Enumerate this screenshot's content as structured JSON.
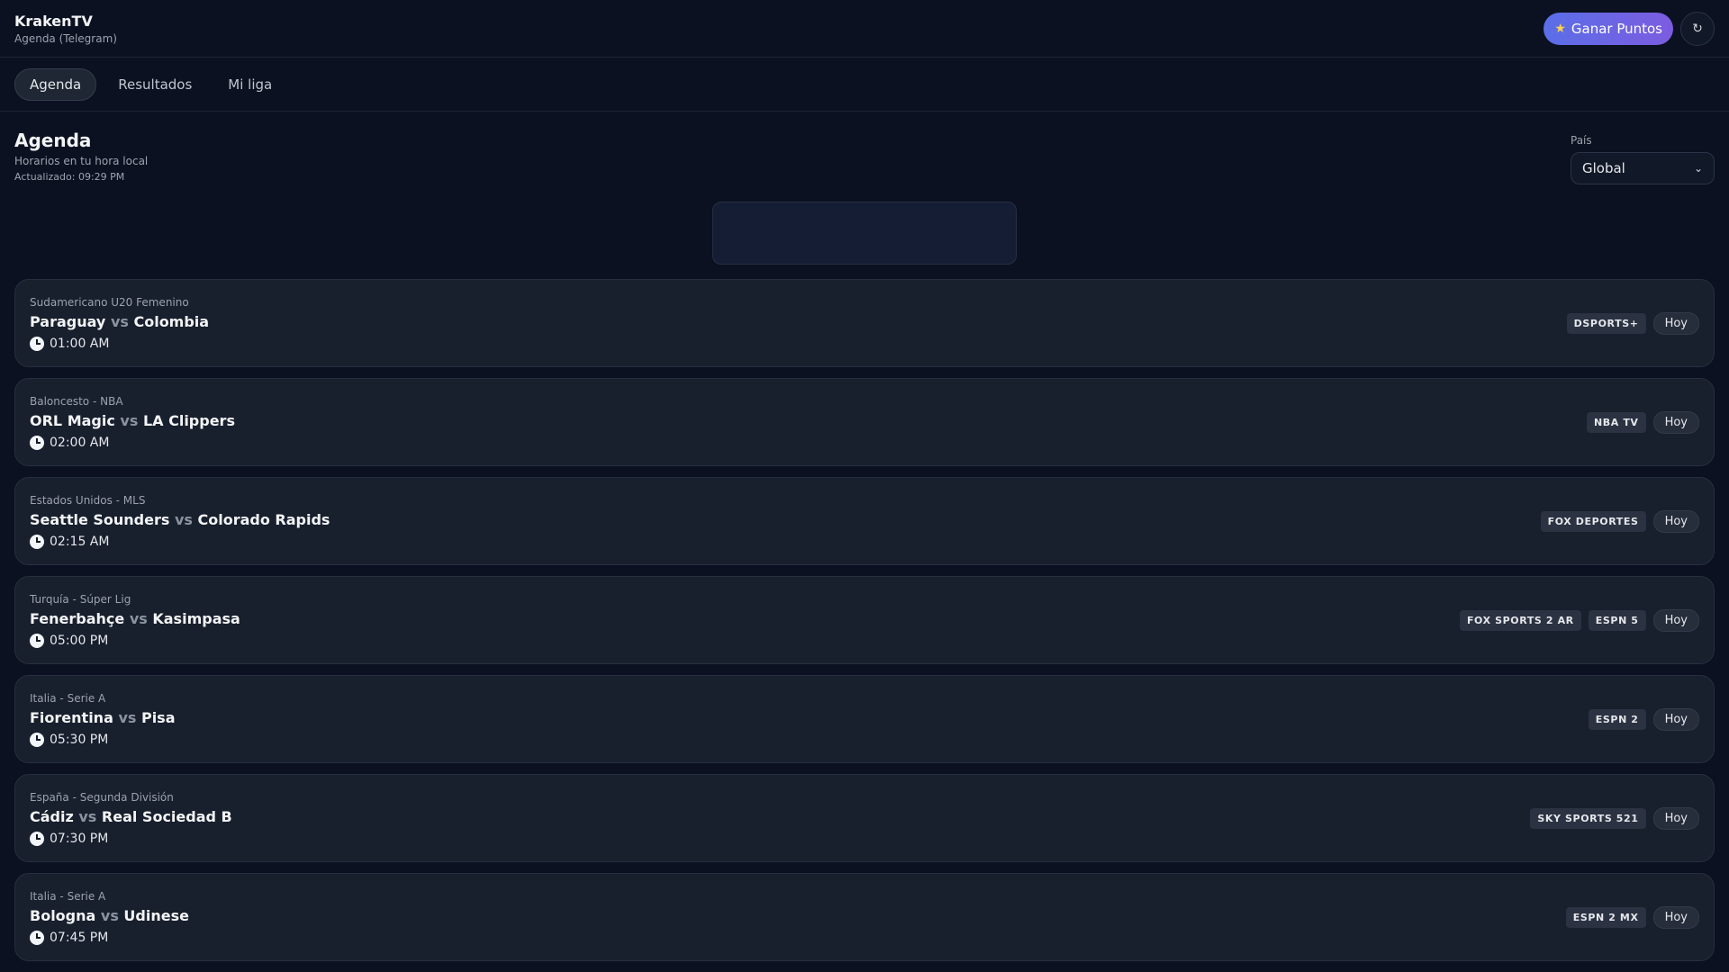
{
  "app": {
    "title": "KrakenTV",
    "subtitle": "Agenda (Telegram)"
  },
  "header": {
    "points_label": "Ganar Puntos",
    "refresh_glyph": "↻"
  },
  "tabs": [
    {
      "label": "Agenda",
      "active": true
    },
    {
      "label": "Resultados",
      "active": false
    },
    {
      "label": "Mi liga",
      "active": false
    }
  ],
  "section": {
    "title": "Agenda",
    "subtitle": "Horarios en tu hora local",
    "updated": "Actualizado: 09:29 PM"
  },
  "country": {
    "label": "País",
    "value": "Global"
  },
  "vs_label": "vs",
  "matches": [
    {
      "league": "Sudamericano U20 Femenino",
      "home": "Paraguay",
      "away": "Colombia",
      "time": "01:00 AM",
      "channels": [
        "DSPORTS+"
      ],
      "day": "Hoy"
    },
    {
      "league": "Baloncesto - NBA",
      "home": "ORL Magic",
      "away": "LA Clippers",
      "time": "02:00 AM",
      "channels": [
        "NBA TV"
      ],
      "day": "Hoy"
    },
    {
      "league": "Estados Unidos - MLS",
      "home": "Seattle Sounders",
      "away": "Colorado Rapids",
      "time": "02:15 AM",
      "channels": [
        "FOX DEPORTES"
      ],
      "day": "Hoy"
    },
    {
      "league": "Turquía - Súper Lig",
      "home": "Fenerbahçe",
      "away": "Kasimpasa",
      "time": "05:00 PM",
      "channels": [
        "FOX SPORTS 2 AR",
        "ESPN 5"
      ],
      "day": "Hoy"
    },
    {
      "league": "Italia - Serie A",
      "home": "Fiorentina",
      "away": "Pisa",
      "time": "05:30 PM",
      "channels": [
        "ESPN 2"
      ],
      "day": "Hoy"
    },
    {
      "league": "España - Segunda División",
      "home": "Cádiz",
      "away": "Real Sociedad B",
      "time": "07:30 PM",
      "channels": [
        "SKY SPORTS 521"
      ],
      "day": "Hoy"
    },
    {
      "league": "Italia - Serie A",
      "home": "Bologna",
      "away": "Udinese",
      "time": "07:45 PM",
      "channels": [
        "ESPN 2 MX"
      ],
      "day": "Hoy"
    }
  ]
}
